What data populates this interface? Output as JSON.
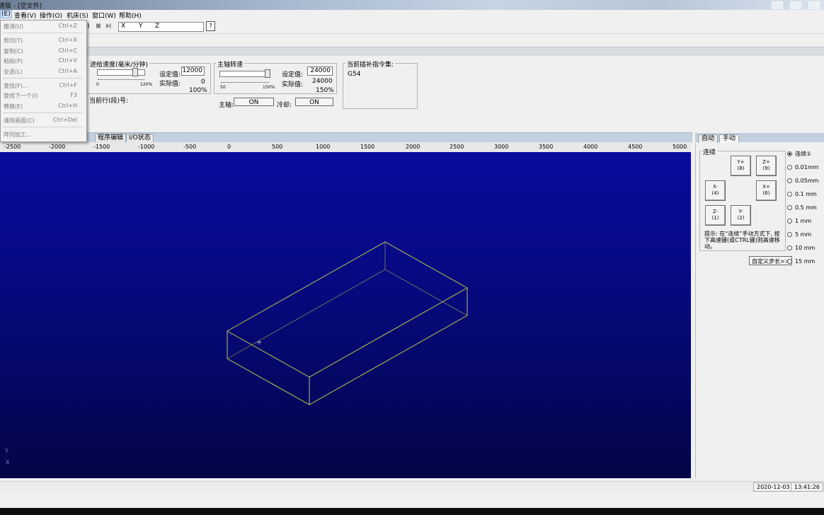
{
  "title": "速版 - [空文件]",
  "menubar": [
    {
      "label": "(E)",
      "active": true
    },
    {
      "label": "查看(V)"
    },
    {
      "label": "操作(O)"
    },
    {
      "label": "机床(S)"
    },
    {
      "label": "窗口(W)"
    },
    {
      "label": "帮助(H)"
    }
  ],
  "edit_menu": [
    {
      "label": "撤消(U)",
      "shortcut": "Ctrl+Z",
      "enabled": false
    },
    {
      "label": "剪切(T)",
      "shortcut": "Ctrl+X",
      "enabled": false
    },
    {
      "label": "复制(C)",
      "shortcut": "Ctrl+C",
      "enabled": false
    },
    {
      "label": "粘贴(P)",
      "shortcut": "Ctrl+V",
      "enabled": false
    },
    {
      "label": "全选(L)",
      "shortcut": "Ctrl+A",
      "enabled": false
    },
    {
      "label": "查找(F)...",
      "shortcut": "Ctrl+F",
      "enabled": false
    },
    {
      "label": "查找下一个(I)",
      "shortcut": "F3",
      "enabled": false
    },
    {
      "label": "替换(E)",
      "shortcut": "Ctrl+H",
      "enabled": false
    },
    {
      "label": "清除画面(C)",
      "shortcut": "Ctrl+Del",
      "enabled": false
    },
    {
      "label": "阵列加工...",
      "shortcut": "",
      "enabled": false
    }
  ],
  "toolbar": {
    "coord_x": "X",
    "coord_y": "Y",
    "coord_z": "Z",
    "help_glyph": "?",
    "icons": [
      "pause-icon",
      "stop-icon",
      "step-icon"
    ]
  },
  "feed": {
    "title": "进给速度(毫米/分钟)",
    "set_label": "设定值:",
    "set_value": "12000",
    "actual_label": "实际值:",
    "actual_value": "0",
    "percent": "100%",
    "tick_min": "0",
    "tick_max": "120%",
    "slider_fraction": 0.83
  },
  "spindle": {
    "title": "主轴转速",
    "set_label": "设定值:",
    "set_value": "24000",
    "actual_label": "实际值:",
    "actual_value": "24000",
    "percent": "150%",
    "tick_min": "50",
    "tick_max": "150%",
    "slider_fraction": 1.0
  },
  "gcode_group": {
    "title": "当前插补指令集:",
    "value": "G54"
  },
  "current_line_label": "当前行(段)号:",
  "spindle_toggle": {
    "label": "主轴:",
    "value": "ON"
  },
  "coolant_toggle": {
    "label": "冷却:",
    "value": "ON"
  },
  "tabs": [
    "程序编辑",
    "I/O状态"
  ],
  "ruler": [
    "-2500",
    "-2000",
    "-1500",
    "-1000",
    "-500",
    "0",
    "500",
    "1000",
    "1500",
    "2000",
    "2500",
    "3000",
    "3500",
    "4000",
    "4500",
    "5000"
  ],
  "viewport": {
    "axis_y": "Y",
    "axis_x": "X",
    "origin_marker": "+",
    "wire_color": "#b9c64a",
    "bg_color_top": "#0a0b9e",
    "bg_color_bottom": "#030547"
  },
  "right_panel": {
    "tabs": [
      {
        "label": "自动"
      },
      {
        "label": "手动",
        "selected": true
      }
    ],
    "group_title": "连续",
    "jog_buttons": {
      "yplus": {
        "axis": "Y+",
        "key": "(8)"
      },
      "zplus": {
        "axis": "Z+",
        "key": "(9)"
      },
      "xminus": {
        "axis": "X-",
        "key": "(4)"
      },
      "xplus": {
        "axis": "X+",
        "key": "(6)"
      },
      "zminus": {
        "axis": "Z-",
        "key": "(1)"
      },
      "yminus": {
        "axis": "Y-",
        "key": "(2)"
      }
    },
    "hint": "提示: 在“连续”手动方式下, 按下高速键(或CTRL键)则高速移动。",
    "custom_step_button": "自定义步长>>",
    "step_options": [
      {
        "label": "连续①",
        "selected": true
      },
      {
        "label": "0.01mm"
      },
      {
        "label": "0.05mm"
      },
      {
        "label": "0.1  mm"
      },
      {
        "label": "0.5  mm"
      },
      {
        "label": "1    mm"
      },
      {
        "label": "5    mm"
      },
      {
        "label": "10   mm"
      },
      {
        "label": "15   mm"
      }
    ]
  },
  "status": {
    "date": "2020-12-03",
    "time": "13:41:26"
  }
}
